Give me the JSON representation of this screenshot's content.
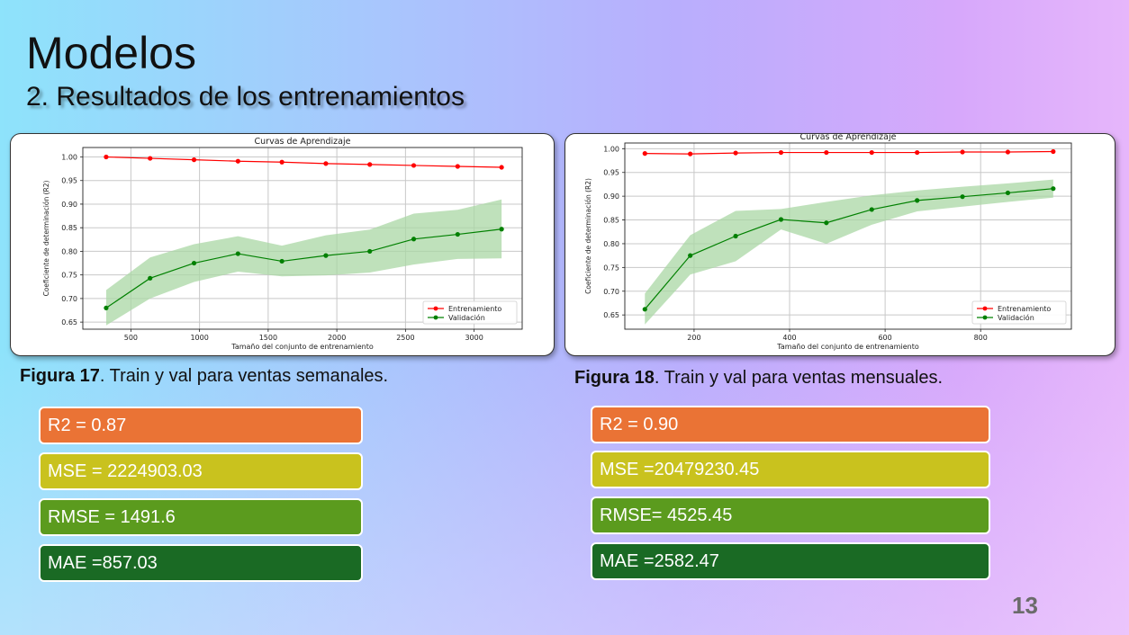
{
  "slide": {
    "title": "Modelos",
    "subtitle": "2. Resultados de los entrenamientos",
    "page_number": "13"
  },
  "colors": {
    "train": "#ff0000",
    "val": "#008000",
    "band": "#a9d7a4",
    "r2": "#ea7335",
    "mse": "#c9c21e",
    "rmse": "#5b9b1e",
    "mae": "#1a6a24"
  },
  "figures": [
    {
      "caption_bold": "Figura 17",
      "caption_text": ". Train y val para ventas semanales.",
      "metrics": [
        {
          "label": "R2 = 0.87",
          "color_key": "r2"
        },
        {
          "label": "MSE = 2224903.03",
          "color_key": "mse"
        },
        {
          "label": "RMSE = 1491.6",
          "color_key": "rmse"
        },
        {
          "label": "MAE =857.03",
          "color_key": "mae"
        }
      ]
    },
    {
      "caption_bold": "Figura 18",
      "caption_text": ". Train y val para ventas mensuales.",
      "metrics": [
        {
          "label": "R2 = 0.90",
          "color_key": "r2"
        },
        {
          "label": "MSE =20479230.45",
          "color_key": "mse"
        },
        {
          "label": "RMSE= 4525.45",
          "color_key": "rmse"
        },
        {
          "label": "MAE =2582.47",
          "color_key": "mae"
        }
      ]
    }
  ],
  "chart_data": [
    {
      "type": "line",
      "title": "Curvas de Aprendizaje",
      "xlabel": "Tamaño del conjunto de entrenamiento",
      "ylabel": "Coeficiente de determinación (R2)",
      "xlim": [
        150,
        3350
      ],
      "ylim": [
        0.635,
        1.02
      ],
      "xticks": [
        500,
        1000,
        1500,
        2000,
        2500,
        3000
      ],
      "yticks": [
        0.65,
        0.7,
        0.75,
        0.8,
        0.85,
        0.9,
        0.95,
        1.0
      ],
      "ytick_labels": [
        "0.65",
        "0.70",
        "0.75",
        "0.80",
        "0.85",
        "0.90",
        "0.95",
        "1.00"
      ],
      "grid": true,
      "legend_position": "lower-right",
      "x": [
        320,
        640,
        960,
        1280,
        1600,
        1920,
        2240,
        2560,
        2880,
        3200
      ],
      "series": [
        {
          "name": "Entrenamiento",
          "color_key": "train",
          "values": [
            1.0,
            0.997,
            0.994,
            0.991,
            0.989,
            0.986,
            0.984,
            0.982,
            0.98,
            0.978
          ],
          "band_lower": null,
          "band_upper": null
        },
        {
          "name": "Validación",
          "color_key": "val",
          "values": [
            0.68,
            0.743,
            0.775,
            0.795,
            0.779,
            0.791,
            0.8,
            0.826,
            0.836,
            0.847
          ],
          "band_lower": [
            0.643,
            0.7,
            0.735,
            0.757,
            0.747,
            0.749,
            0.755,
            0.772,
            0.784,
            0.785
          ],
          "band_upper": [
            0.718,
            0.787,
            0.815,
            0.832,
            0.812,
            0.834,
            0.846,
            0.88,
            0.888,
            0.91
          ]
        }
      ]
    },
    {
      "type": "line",
      "title": "Curvas de Aprendizaje",
      "xlabel": "Tamaño del conjunto de entrenamiento",
      "ylabel": "Coeficiente de determinación (R2)",
      "xlim": [
        55,
        990
      ],
      "ylim": [
        0.62,
        1.012
      ],
      "xticks": [
        200,
        400,
        600,
        800
      ],
      "yticks": [
        0.65,
        0.7,
        0.75,
        0.8,
        0.85,
        0.9,
        0.95,
        1.0
      ],
      "ytick_labels": [
        "0.65",
        "0.70",
        "0.75",
        "0.80",
        "0.85",
        "0.90",
        "0.95",
        "1.00"
      ],
      "grid": true,
      "legend_position": "lower-right",
      "x": [
        97,
        192,
        287,
        382,
        477,
        572,
        667,
        762,
        857,
        952
      ],
      "series": [
        {
          "name": "Entrenamiento",
          "color_key": "train",
          "values": [
            0.99,
            0.989,
            0.991,
            0.992,
            0.992,
            0.992,
            0.992,
            0.993,
            0.993,
            0.994
          ],
          "band_lower": null,
          "band_upper": null
        },
        {
          "name": "Validación",
          "color_key": "val",
          "values": [
            0.662,
            0.775,
            0.816,
            0.851,
            0.844,
            0.872,
            0.891,
            0.899,
            0.907,
            0.916
          ],
          "band_lower": [
            0.63,
            0.735,
            0.763,
            0.83,
            0.8,
            0.84,
            0.868,
            0.878,
            0.888,
            0.897
          ],
          "band_upper": [
            0.695,
            0.818,
            0.869,
            0.873,
            0.888,
            0.902,
            0.912,
            0.92,
            0.927,
            0.935
          ]
        }
      ]
    }
  ]
}
